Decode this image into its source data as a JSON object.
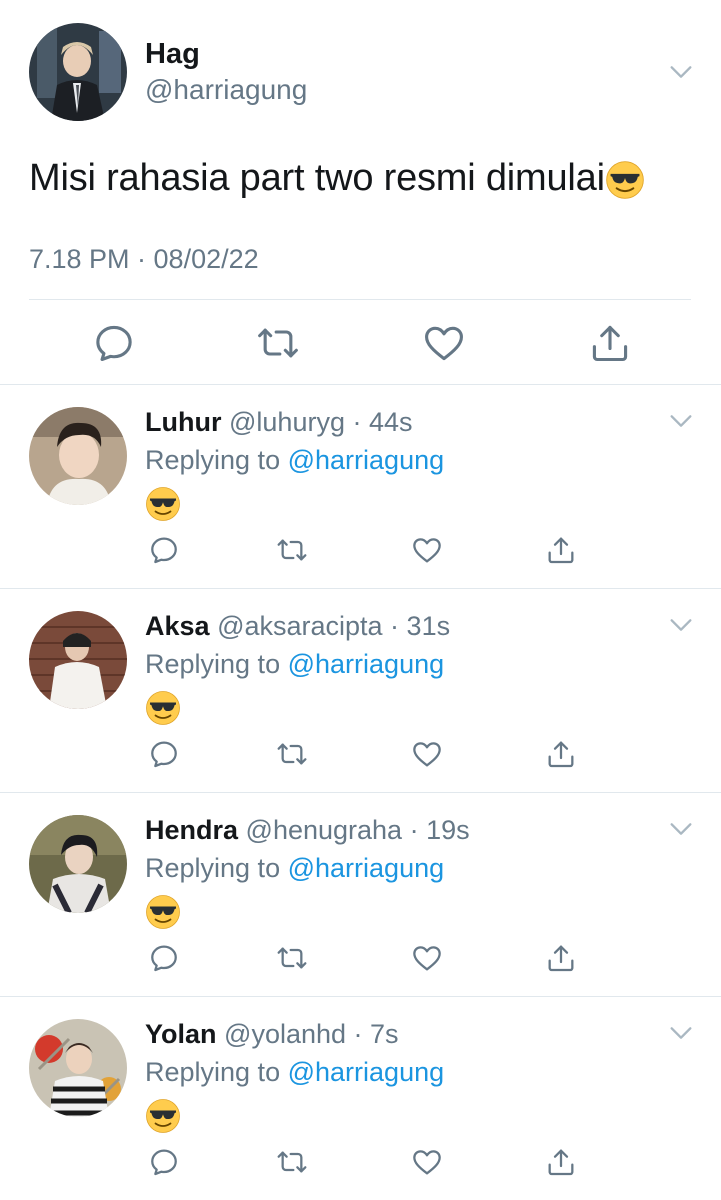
{
  "main_tweet": {
    "name": "Hag",
    "handle": "@harriagung",
    "text": "Misi rahasia part two resmi dimulai",
    "text_emoji": "smiling-face-with-sunglasses",
    "timestamp": "7.18 PM · 08/02/22",
    "actions": [
      "reply-icon",
      "retweet-icon",
      "like-icon",
      "share-icon"
    ]
  },
  "replies": [
    {
      "name": "Luhur",
      "handle": "@luhuryg",
      "time": "44s",
      "replying_prefix": "Replying to",
      "replying_to": "@harriagung",
      "emoji": "smiling-face-with-sunglasses"
    },
    {
      "name": "Aksa",
      "handle": "@aksaracipta",
      "time": "31s",
      "replying_prefix": "Replying to",
      "replying_to": "@harriagung",
      "emoji": "smiling-face-with-sunglasses"
    },
    {
      "name": "Hendra",
      "handle": "@henugraha",
      "time": "19s",
      "replying_prefix": "Replying to",
      "replying_to": "@harriagung",
      "emoji": "smiling-face-with-sunglasses"
    },
    {
      "name": "Yolan",
      "handle": "@yolanhd",
      "time": "7s",
      "replying_prefix": "Replying to",
      "replying_to": "@harriagung",
      "emoji": "smiling-face-with-sunglasses"
    }
  ],
  "separator": " · ",
  "colors": {
    "name": "#14171a",
    "secondary": "#657786",
    "link": "#1b95e0",
    "divider": "#e1e8ed",
    "icon": "#657786"
  }
}
